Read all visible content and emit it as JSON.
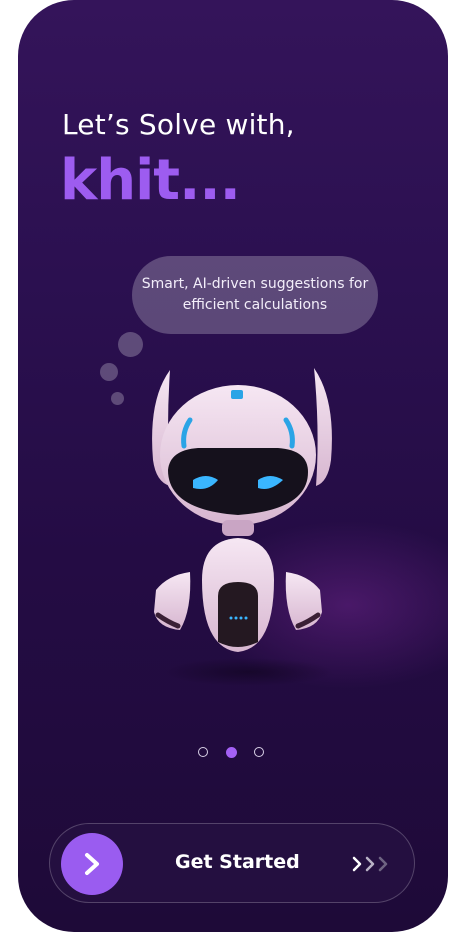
{
  "header": {
    "line1": "Let’s Solve with,",
    "brand": "khit..."
  },
  "bubble": {
    "text": "Smart, AI-driven suggestions for efficient calculations"
  },
  "pagination": {
    "total": 3,
    "active_index": 1
  },
  "cta": {
    "label": "Get Started"
  },
  "icons": {
    "cta_arrow": "chevron-right-icon",
    "cta_trail": "triple-chevron-icon",
    "mascot": "robot-mascot"
  },
  "colors": {
    "brand_purple": "#9d5cf0",
    "background": "#2b1050",
    "eye_blue": "#3ab6ff"
  }
}
